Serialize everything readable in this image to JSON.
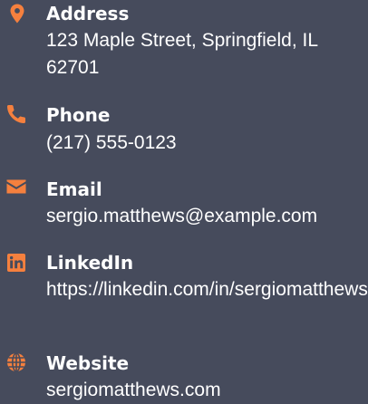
{
  "colors": {
    "background": "#464b5c",
    "accent": "#f5803e",
    "text": "#ffffff"
  },
  "contacts": [
    {
      "icon": "map-marker-icon",
      "label": "Address",
      "value_line1": "123 Maple Street, Springfield, IL",
      "value_line2": "62701"
    },
    {
      "icon": "phone-icon",
      "label": "Phone",
      "value": "(217) 555-0123"
    },
    {
      "icon": "envelope-icon",
      "label": "Email",
      "value": "sergio.matthews@example.com"
    },
    {
      "icon": "linkedin-icon",
      "label": "LinkedIn",
      "value": "https://linkedin.com/in/sergiomatthews"
    },
    {
      "icon": "globe-icon",
      "label": "Website",
      "value": "sergiomatthews.com"
    }
  ]
}
